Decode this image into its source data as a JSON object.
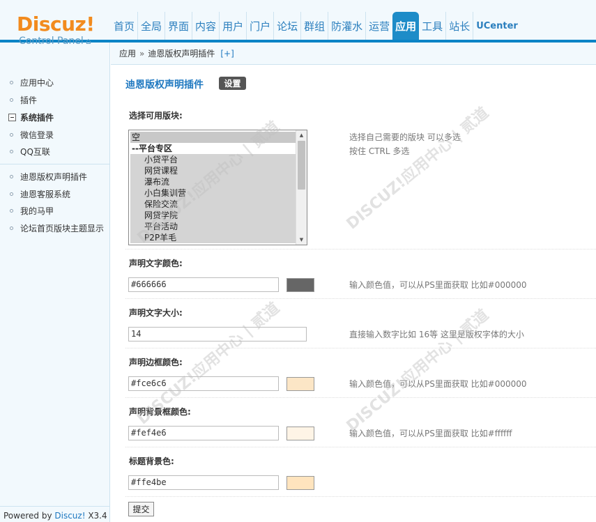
{
  "logo": {
    "brand": "Discuz!",
    "subtitle": "Control Panel"
  },
  "nav": [
    "首页",
    "全局",
    "界面",
    "内容",
    "用户",
    "门户",
    "论坛",
    "群组",
    "防灌水",
    "运营",
    "应用",
    "工具",
    "站长",
    "UCenter"
  ],
  "nav_active": "应用",
  "breadcrumb": {
    "root": "应用",
    "sep": "»",
    "current": "迪恩版权声明插件",
    "add": "[+]"
  },
  "sidebar": {
    "items_top": [
      "应用中心",
      "插件"
    ],
    "section": "系统插件",
    "items_mid": [
      "微信登录",
      "QQ互联"
    ],
    "items_plugins": [
      "迪恩版权声明插件",
      "迪恩客服系统",
      "我的马甲",
      "论坛首页版块主题显示"
    ],
    "powered_prefix": "Powered by ",
    "powered_link": "Discuz!",
    "powered_version": " X3.4"
  },
  "main": {
    "title": "迪恩版权声明插件",
    "badge": "设置",
    "select_label": "选择可用版块:",
    "select_hint_1": "选择自己需要的版块 可以多选",
    "select_hint_2": "按住 CTRL 多选",
    "select_options": [
      "空",
      "--平台专区",
      "小贷平台",
      "网贷课程",
      "瀑布流",
      "小白集训营",
      "保险交流",
      "网贷学院",
      "平台活动",
      "P2P羊毛"
    ],
    "text_color_label": "声明文字颜色:",
    "text_color_value": "#666666",
    "text_color_hint": "输入颜色值，可以从PS里面获取 比如#000000",
    "font_size_label": "声明文字大小:",
    "font_size_value": "14",
    "font_size_hint": "直接输入数字比如 16等 这里是版权字体的大小",
    "border_color_label": "声明边框颜色:",
    "border_color_value": "#fce6c6",
    "border_color_hint": "输入颜色值，可以从PS里面获取 比如#000000",
    "bg_color_label": "声明背景框颜色:",
    "bg_color_value": "#fef4e6",
    "bg_color_hint": "输入颜色值，可以从PS里面获取 比如#ffffff",
    "title_bg_label": "标题背景色:",
    "title_bg_value": "#ffe4be",
    "submit": "提交"
  },
  "colors": {
    "swatch_text": "#666666",
    "swatch_border": "#fce6c6",
    "swatch_bg": "#fef4e6",
    "swatch_title": "#ffe4be",
    "accent": "#1e78c0",
    "brand_orange": "#f28b1e"
  },
  "watermark": "DISCUZ!应用中心 | 贰道"
}
